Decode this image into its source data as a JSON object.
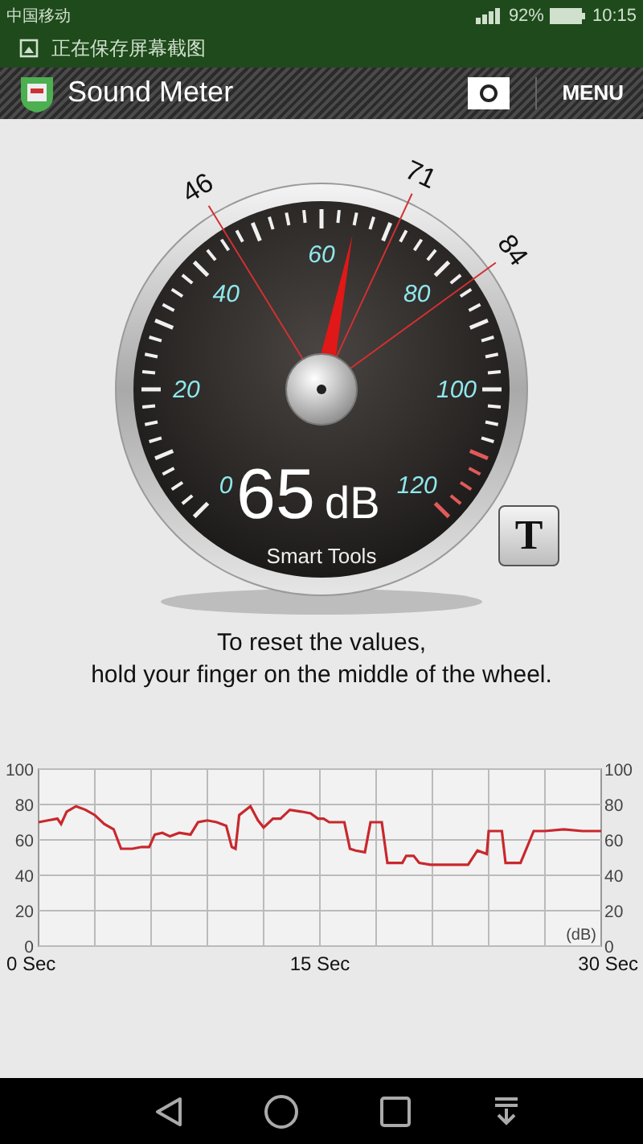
{
  "status_bar": {
    "carrier": "中国移动",
    "battery": "92%",
    "time": "10:15"
  },
  "notification": {
    "text": "正在保存屏幕截图"
  },
  "app_bar": {
    "title": "Sound Meter",
    "menu": "MENU"
  },
  "gauge": {
    "scale_labels": [
      "0",
      "20",
      "40",
      "60",
      "80",
      "100",
      "120"
    ],
    "needle": {
      "level": 0.542
    },
    "reading": "65",
    "unit": "dB",
    "brand": "Smart Tools",
    "markers": [
      {
        "label": "46",
        "level": 0.383
      },
      {
        "label": "71",
        "level": 0.592
      },
      {
        "label": "84",
        "level": 0.7
      }
    ]
  },
  "font_button": {
    "label": "T"
  },
  "instruction": [
    "To reset the values,",
    "hold your finger on the middle of the wheel."
  ],
  "chart": {
    "chart_data": {
      "type": "line",
      "ylabel": "(dB)",
      "x": [
        0,
        0.5,
        1,
        1.2,
        1.5,
        2,
        2.5,
        3,
        3.5,
        4,
        4.4,
        5,
        5.5,
        5.9,
        6.2,
        6.6,
        7,
        7.5,
        8.1,
        8.5,
        9,
        9.5,
        10,
        10.3,
        10.5,
        10.7,
        11.3,
        11.7,
        12,
        12.5,
        12.9,
        13.4,
        14,
        14.5,
        14.9,
        15.2,
        15.5,
        16.3,
        16.6,
        16.9,
        17.4,
        17.7,
        18.3,
        18.6,
        19.4,
        19.6,
        20,
        20.3,
        20.9,
        22.9,
        23.4,
        23.9,
        24,
        24.7,
        24.9,
        25.7,
        26.4,
        27,
        28,
        29,
        30
      ],
      "series": [
        {
          "color": "#c8282d",
          "values": [
            70,
            71,
            72,
            69,
            76,
            79,
            77,
            74,
            69,
            66,
            55,
            55,
            56,
            56,
            63,
            64,
            62,
            64,
            63,
            70,
            71,
            70,
            68,
            56,
            55,
            74,
            79,
            71,
            67,
            72,
            72,
            77,
            76,
            75,
            72,
            72,
            70,
            70,
            55,
            54,
            53,
            70,
            70,
            47,
            47,
            51,
            51,
            47,
            46,
            46,
            54,
            52,
            65,
            65,
            47,
            47,
            65,
            65,
            66,
            65,
            65
          ]
        }
      ],
      "xlim": [
        0,
        30
      ],
      "ylim": [
        0,
        100
      ],
      "xticks": [
        {
          "value": 0,
          "label": "0 Sec"
        },
        {
          "value": 15,
          "label": "15 Sec"
        },
        {
          "value": 30,
          "label": "30 Sec"
        }
      ],
      "yticks": [
        0,
        20,
        40,
        60,
        80,
        100
      ],
      "grid": true
    },
    "right_axis_labels": [
      "100",
      "80",
      "60",
      "40",
      "20",
      "0"
    ]
  }
}
